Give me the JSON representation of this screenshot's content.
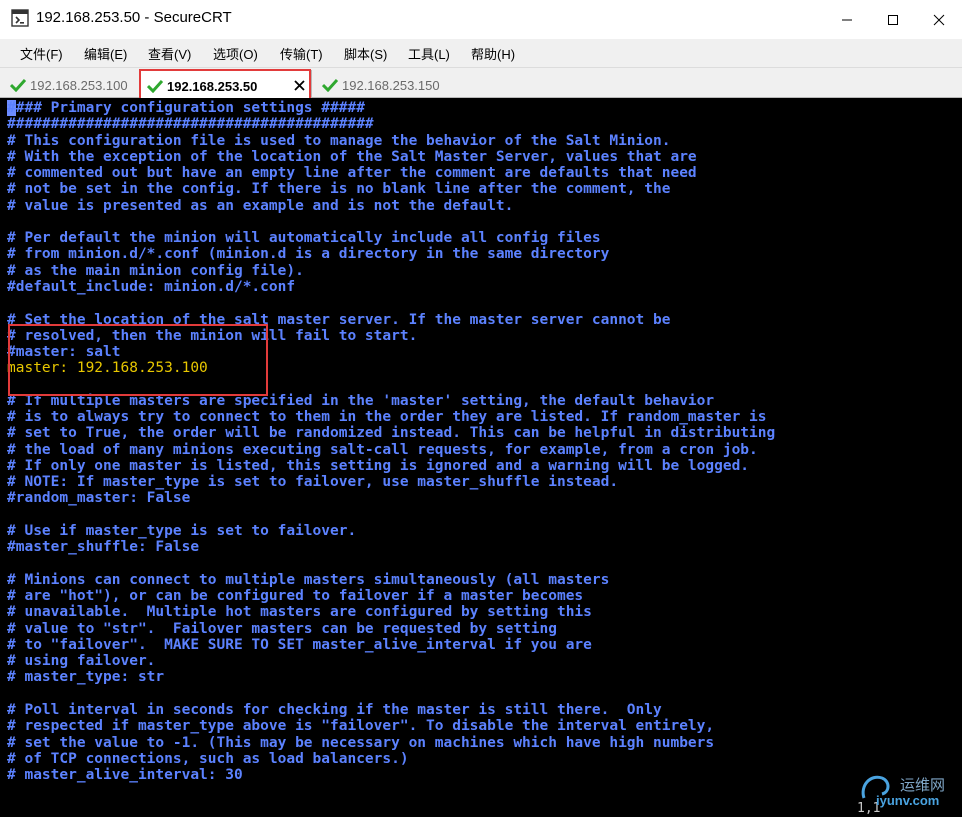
{
  "window": {
    "title": "192.168.253.50 - SecureCRT"
  },
  "menu": [
    {
      "label": "文件(F)"
    },
    {
      "label": "编辑(E)"
    },
    {
      "label": "查看(V)"
    },
    {
      "label": "选项(O)"
    },
    {
      "label": "传输(T)"
    },
    {
      "label": "脚本(S)"
    },
    {
      "label": "工具(L)"
    },
    {
      "label": "帮助(H)"
    }
  ],
  "tabs": [
    {
      "label": "192.168.253.100",
      "active": false
    },
    {
      "label": "192.168.253.50",
      "active": true
    },
    {
      "label": "192.168.253.150",
      "active": false
    }
  ],
  "terminal": {
    "lines": [
      "#### Primary configuration settings #####",
      "##########################################",
      "# This configuration file is used to manage the behavior of the Salt Minion.",
      "# With the exception of the location of the Salt Master Server, values that are",
      "# commented out but have an empty line after the comment are defaults that need",
      "# not be set in the config. If there is no blank line after the comment, the",
      "# value is presented as an example and is not the default.",
      "",
      "# Per default the minion will automatically include all config files",
      "# from minion.d/*.conf (minion.d is a directory in the same directory",
      "# as the main minion config file).",
      "#default_include: minion.d/*.conf",
      "",
      "# Set the location of the salt master server. If the master server cannot be",
      "# resolved, then the minion will fail to start.",
      "#master: salt",
      "master: 192.168.253.100",
      "",
      "# If multiple masters are specified in the 'master' setting, the default behavior",
      "# is to always try to connect to them in the order they are listed. If random_master is",
      "# set to True, the order will be randomized instead. This can be helpful in distributing",
      "# the load of many minions executing salt-call requests, for example, from a cron job.",
      "# If only one master is listed, this setting is ignored and a warning will be logged.",
      "# NOTE: If master_type is set to failover, use master_shuffle instead.",
      "#random_master: False",
      "",
      "# Use if master_type is set to failover.",
      "#master_shuffle: False",
      "",
      "# Minions can connect to multiple masters simultaneously (all masters",
      "# are \"hot\"), or can be configured to failover if a master becomes",
      "# unavailable.  Multiple hot masters are configured by setting this",
      "# value to \"str\".  Failover masters can be requested by setting",
      "# to \"failover\".  MAKE SURE TO SET master_alive_interval if you are",
      "# using failover.",
      "# master_type: str",
      "",
      "# Poll interval in seconds for checking if the master is still there.  Only",
      "# respected if master_type above is \"failover\". To disable the interval entirely,",
      "# set the value to -1. (This may be necessary on machines which have high numbers",
      "# of TCP connections, such as load balancers.)",
      "# master_alive_interval: 30"
    ],
    "cursor_position": "1,1"
  },
  "watermark": {
    "text_cn": "运维网",
    "text_en": "iyunv.com"
  },
  "colors": {
    "comment": "#5c82ff",
    "value": "#e8c700",
    "highlight": "#e23b3b",
    "background": "#000000"
  }
}
